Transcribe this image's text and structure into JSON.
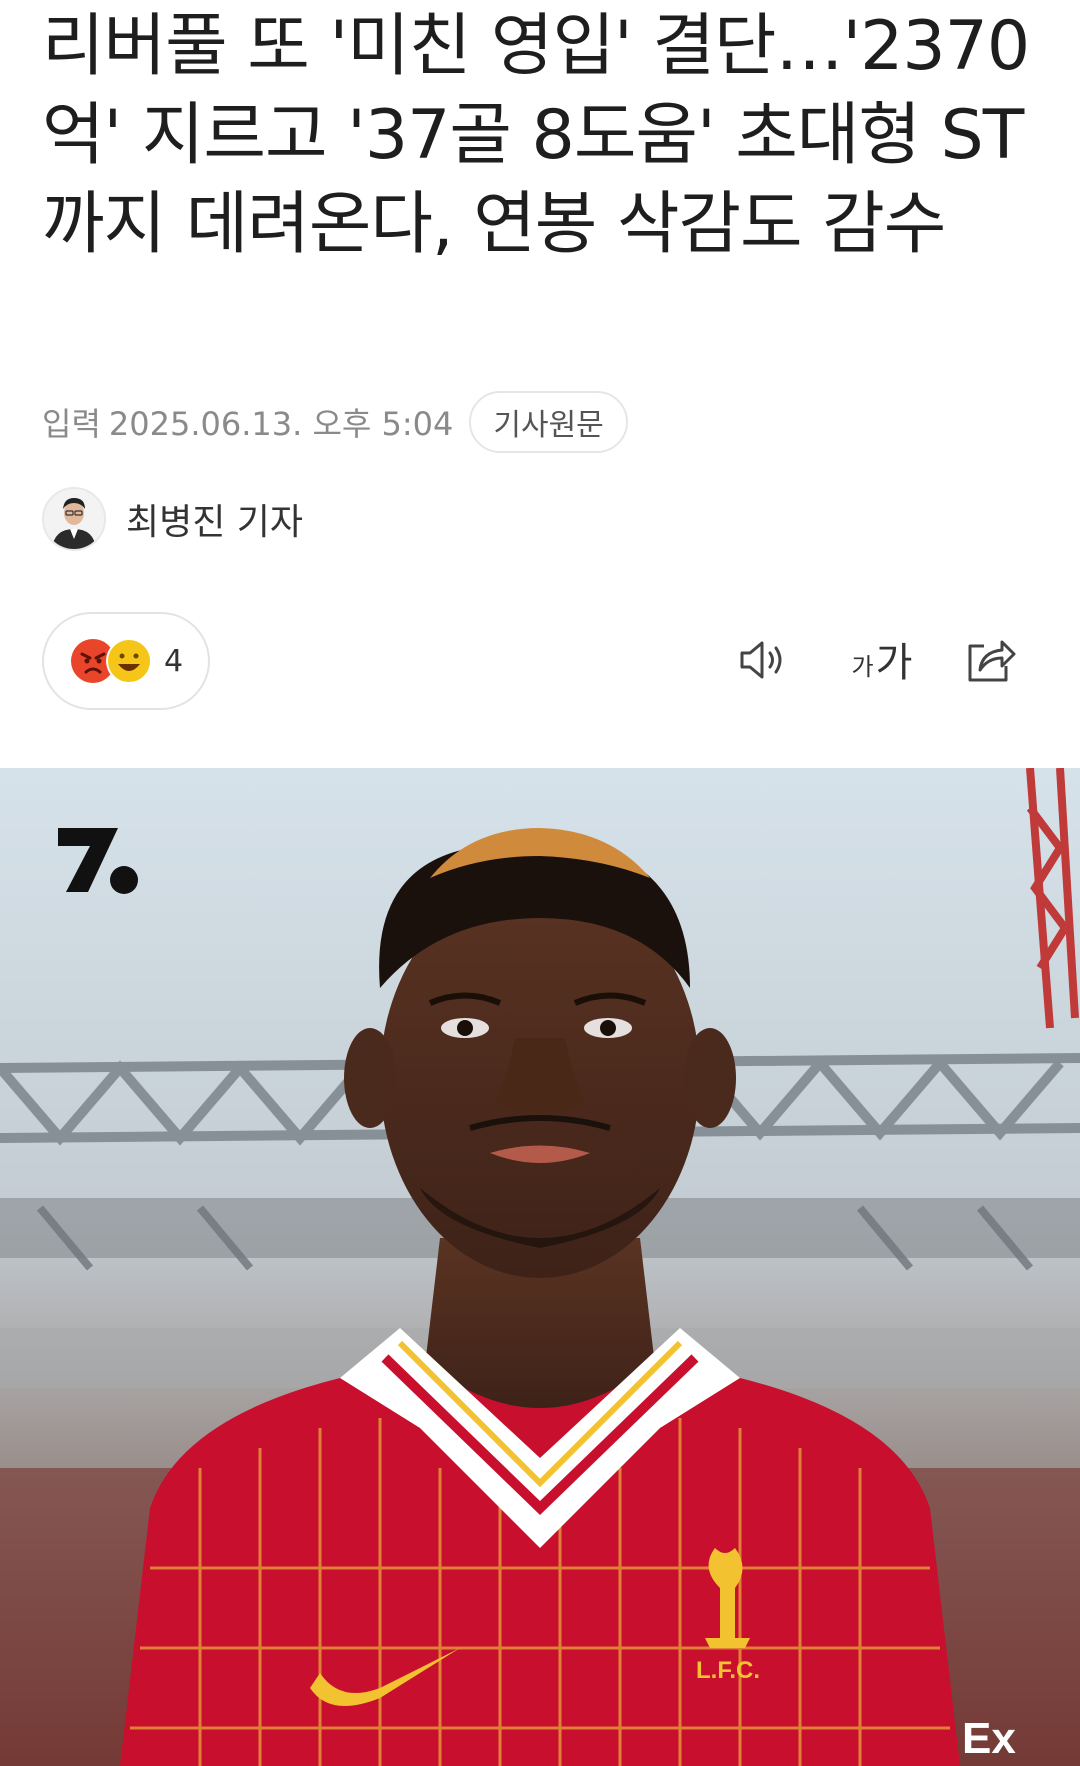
{
  "article": {
    "title": "리버풀 또 '미친 영입' 결단…'2370억' 지르고 '37골 8도움' 초대형 ST까지 데려온다, 연봉 삭감도 감수",
    "meta": {
      "input_label": "입력",
      "datetime": "2025.06.13. 오후 5:04",
      "original_button": "기사원문"
    },
    "reporter": {
      "name": "최병진 기자"
    },
    "reactions": {
      "count": "4",
      "emojis": [
        "angry-emoji",
        "happy-emoji"
      ]
    },
    "toolbar": {
      "font_small": "가",
      "font_big": "가",
      "icons": [
        "speaker-icon",
        "font-size-icon",
        "share-icon"
      ]
    },
    "image": {
      "logo_text": "%",
      "crest_text": "L.F.C.",
      "sponsor_text": "Ex"
    }
  },
  "colors": {
    "text_primary": "#1e1e1e",
    "text_meta": "#8a8a8a",
    "border": "#e3e3e3",
    "jersey_red": "#c8102e",
    "angry_red": "#e8452a",
    "happy_yellow": "#f5c518"
  }
}
